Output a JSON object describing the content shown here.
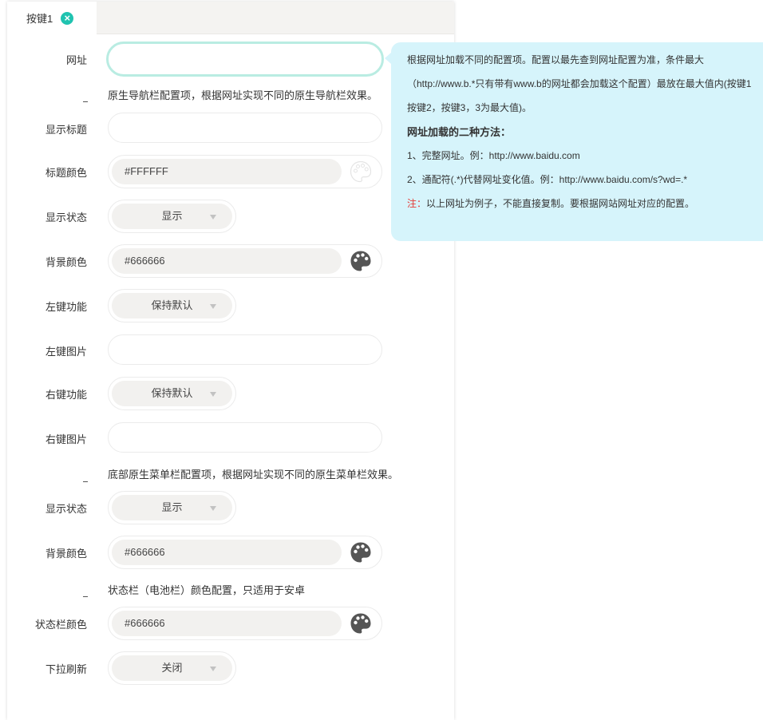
{
  "tab": {
    "label": "按键1"
  },
  "nav": {
    "url_label": "网址",
    "section_title": "原生导航栏配置项，根据网址实现不同的原生导航栏效果。",
    "show_title_label": "显示标题",
    "title_color_label": "标题颜色",
    "title_color_value": "#FFFFFF",
    "show_state_label": "显示状态",
    "show_state_value": "显示",
    "bg_color_label": "背景颜色",
    "bg_color_value": "#666666",
    "left_fn_label": "左键功能",
    "left_fn_value": "保持默认",
    "left_img_label": "左键图片",
    "right_fn_label": "右键功能",
    "right_fn_value": "保持默认",
    "right_img_label": "右键图片"
  },
  "bottom_menu": {
    "section_title": "底部原生菜单栏配置项，根据网址实现不同的原生菜单栏效果。",
    "show_state_label": "显示状态",
    "show_state_value": "显示",
    "bg_color_label": "背景颜色",
    "bg_color_value": "#666666"
  },
  "status_bar": {
    "section_title": "状态栏（电池栏）颜色配置，只适用于安卓",
    "color_label": "状态栏颜色",
    "color_value": "#666666"
  },
  "pull_refresh": {
    "label": "下拉刷新",
    "value": "关闭"
  },
  "tooltip": {
    "line1": "根据网址加载不同的配置项。配置以最先查到网址配置为准，条件最大",
    "line2": "（http://www.b.*只有带有www.b的网址都会加载这个配置）最放在最大值内(按键1",
    "line3": "按键2，按键3，3为最大值)。",
    "heading": "网址加载的二种方法：",
    "item1": "1、完整网址。例：http://www.baidu.com",
    "item2": "2、通配符(.*)代替网址变化值。例：http://www.baidu.com/s?wd=.*",
    "note_prefix": "注：",
    "note_text": "以上网址为例子，不能直接复制。要根据网站网址对应的配置。"
  },
  "colors": {
    "accent": "#20c3b0",
    "tooltip_bg": "#d6f4fb",
    "active_border": "#b9ece2",
    "note_red": "#e53935"
  },
  "icons": {
    "tab_close": "close-circle-icon",
    "palette": "palette-icon",
    "dropdown": "caret-down-icon"
  }
}
